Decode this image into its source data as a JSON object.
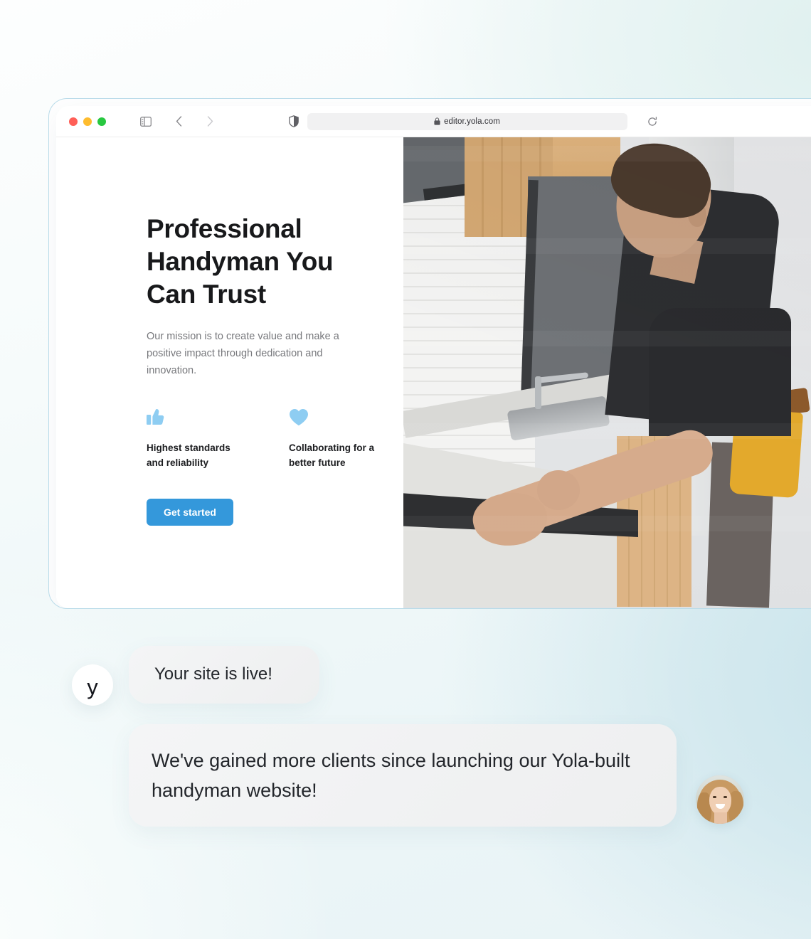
{
  "background": {
    "accent_light_blue": "#c6e2ea",
    "accent_mint": "#dff0ef"
  },
  "browser": {
    "traffic_lights": [
      "close",
      "minimize",
      "maximize"
    ],
    "traffic_colors": {
      "close": "#ff5f57",
      "minimize": "#febc2e",
      "maximize": "#28c840"
    },
    "sidebar_toggle_label": "Show sidebar",
    "back_label": "Back",
    "forward_label": "Forward",
    "shield_label": "Privacy Report",
    "url": "editor.yola.com",
    "reload_label": "Reload",
    "lock_label": "Secure connection"
  },
  "site": {
    "hero": {
      "title": "Professional Handyman You Can Trust",
      "subtitle": "Our mission is to create value and make a positive impact through dedication and innovation.",
      "features": [
        {
          "icon": "thumbs-up-icon",
          "label": "Highest standards and reliability"
        },
        {
          "icon": "heart-icon",
          "label": "Collaborating for a better future"
        }
      ],
      "cta_label": "Get started",
      "cta_color": "#3498db",
      "icon_color": "#8ecdf2",
      "photo_alt": "Handyman installing a cooktop in a modern kitchen"
    }
  },
  "chat": {
    "brand_initial": "y",
    "messages": [
      {
        "from": "yola",
        "text": "Your site is live!"
      },
      {
        "from": "customer",
        "text": "We've gained more clients since launching our Yola-built handyman website!"
      }
    ],
    "customer_avatar_alt": "Smiling woman portrait"
  }
}
